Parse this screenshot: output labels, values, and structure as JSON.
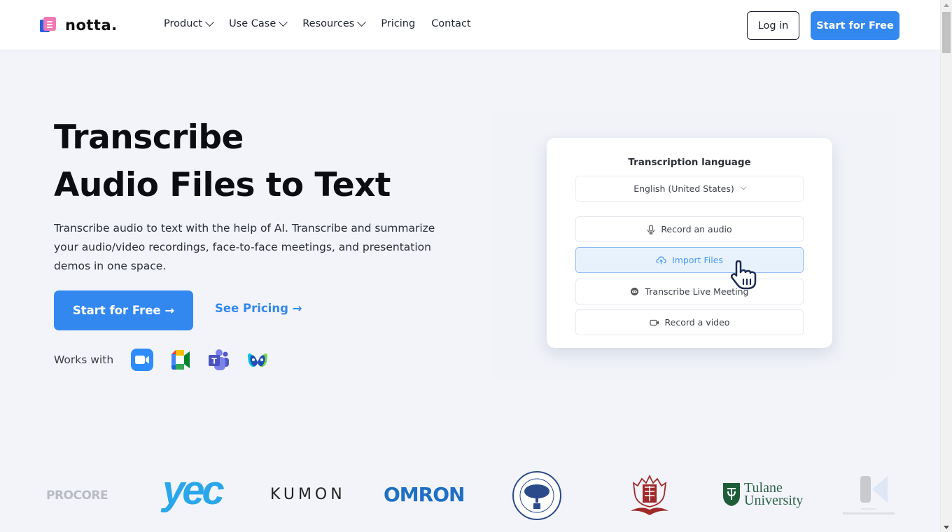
{
  "header": {
    "logo_text": "notta.",
    "nav": [
      {
        "label": "Product",
        "has_dropdown": true
      },
      {
        "label": "Use Case",
        "has_dropdown": true
      },
      {
        "label": "Resources",
        "has_dropdown": true
      },
      {
        "label": "Pricing",
        "has_dropdown": false
      },
      {
        "label": "Contact",
        "has_dropdown": false
      }
    ],
    "login_label": "Log in",
    "start_label": "Start for Free"
  },
  "hero": {
    "title_line1": "Transcribe",
    "title_line2": "Audio Files to Text",
    "description": "Transcribe audio to text with the help of AI. Transcribe and summarize your audio/video recordings, face-to-face meetings, and presentation demos in one space.",
    "cta_start": "Start for Free →",
    "cta_pricing": "See Pricing →",
    "works_with_label": "Works with",
    "integrations": [
      {
        "name": "Zoom",
        "icon": "zoom-icon"
      },
      {
        "name": "Google Meet",
        "icon": "google-meet-icon"
      },
      {
        "name": "Microsoft Teams",
        "icon": "teams-icon"
      },
      {
        "name": "Webex",
        "icon": "webex-icon"
      }
    ]
  },
  "card": {
    "title": "Transcription language",
    "language_value": "English (United States)",
    "options": [
      {
        "label": "Record an audio",
        "icon": "microphone-icon",
        "active": false
      },
      {
        "label": "Import Files",
        "icon": "cloud-upload-icon",
        "active": true
      },
      {
        "label": "Transcribe Live Meeting",
        "icon": "meeting-bot-icon",
        "active": false
      },
      {
        "label": "Record a video",
        "icon": "video-camera-icon",
        "active": false
      }
    ]
  },
  "logos": [
    {
      "name": "PROCORE"
    },
    {
      "name": "yec"
    },
    {
      "name": "KUMON"
    },
    {
      "name": "OMRON"
    },
    {
      "name": "Kyoto University"
    },
    {
      "name": "Kansai University"
    },
    {
      "name": "Tulane University",
      "line1": "Tulane",
      "line2": "University"
    },
    {
      "name": "Kanazawa Institute of Technology"
    }
  ],
  "colors": {
    "accent": "#3388f0",
    "background": "#f3f4f9",
    "active_option_bg": "#e8f2fd"
  }
}
